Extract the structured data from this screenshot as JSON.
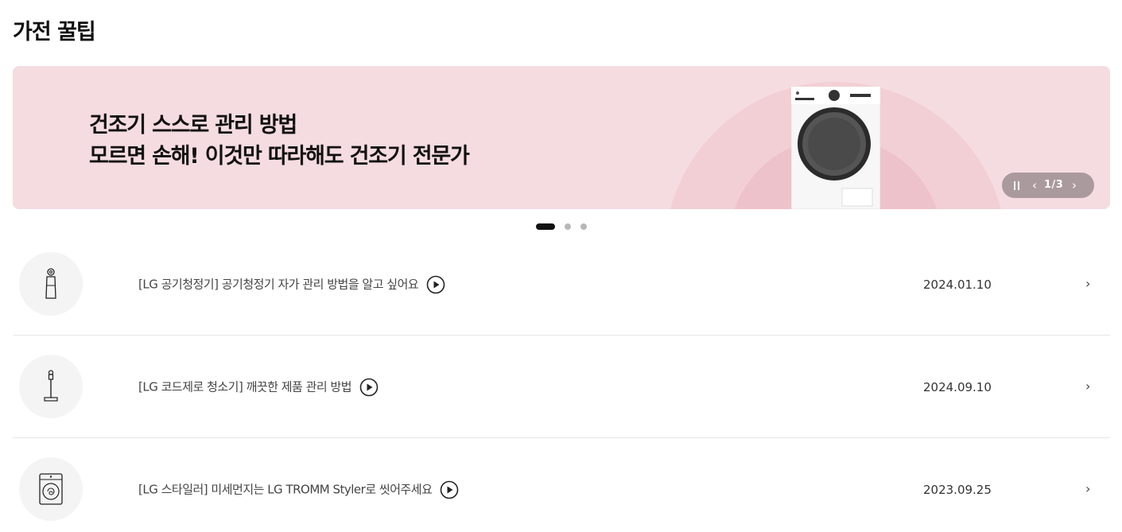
{
  "page": {
    "section_title": "가전 꿀팁"
  },
  "banner": {
    "title": "건조기 스스로 관리 방법",
    "subtitle": "모르면 손해! 이것만 따라해도 건조기 전문가",
    "background_color": "#f5dce0",
    "product_icon": "dryer-illustration",
    "controls": {
      "pause_icon": "pause-icon",
      "prev_icon": "chevron-left-icon",
      "next_icon": "chevron-right-icon",
      "counter": "1/3"
    }
  },
  "pagination": {
    "total": 3,
    "active_index": 0
  },
  "tips": [
    {
      "title": "[LG 공기청정기] 공기청정기 자가 관리 방법을 알고 싶어요",
      "date": "2024.01.10",
      "thumbnail_icon": "air-purifier-icon",
      "has_video": true
    },
    {
      "title": "[LG 코드제로 청소기] 깨끗한 제품 관리 방법",
      "date": "2024.09.10",
      "thumbnail_icon": "stick-vacuum-icon",
      "has_video": true
    },
    {
      "title": "[LG 스타일러] 미세먼지는 LG TROMM Styler로 씻어주세요",
      "date": "2023.09.25",
      "thumbnail_icon": "styler-icon",
      "has_video": true
    }
  ],
  "icons": {
    "video": "play-circle-icon",
    "row_link": "chevron-right-icon"
  }
}
